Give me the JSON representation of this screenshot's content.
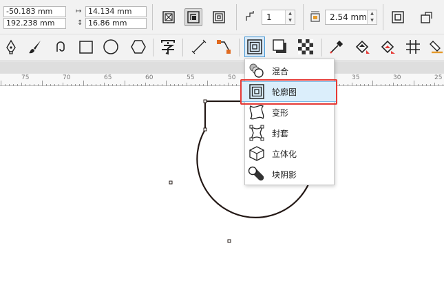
{
  "property_bar": {
    "x_position": "-50.183 mm",
    "y_position": "192.238 mm",
    "width": "14.134 mm",
    "height": "16.86 mm",
    "steps": "1",
    "offset": "2.54 mm"
  },
  "ruler": {
    "labels": [
      "75",
      "70",
      "65",
      "60",
      "55",
      "50",
      "35",
      "30",
      "25"
    ]
  },
  "menu": {
    "items": [
      {
        "label": "混合",
        "icon": "blend-icon"
      },
      {
        "label": "轮廓图",
        "icon": "contour-icon"
      },
      {
        "label": "变形",
        "icon": "distort-icon"
      },
      {
        "label": "封套",
        "icon": "envelope-icon"
      },
      {
        "label": "立体化",
        "icon": "extrude-icon"
      },
      {
        "label": "块阴影",
        "icon": "block-shadow-icon"
      }
    ],
    "selected": "轮廓图"
  },
  "colors": {
    "accent": "#4b9ad6",
    "highlight": "#e53935",
    "selected_bg": "#dbeefb"
  }
}
